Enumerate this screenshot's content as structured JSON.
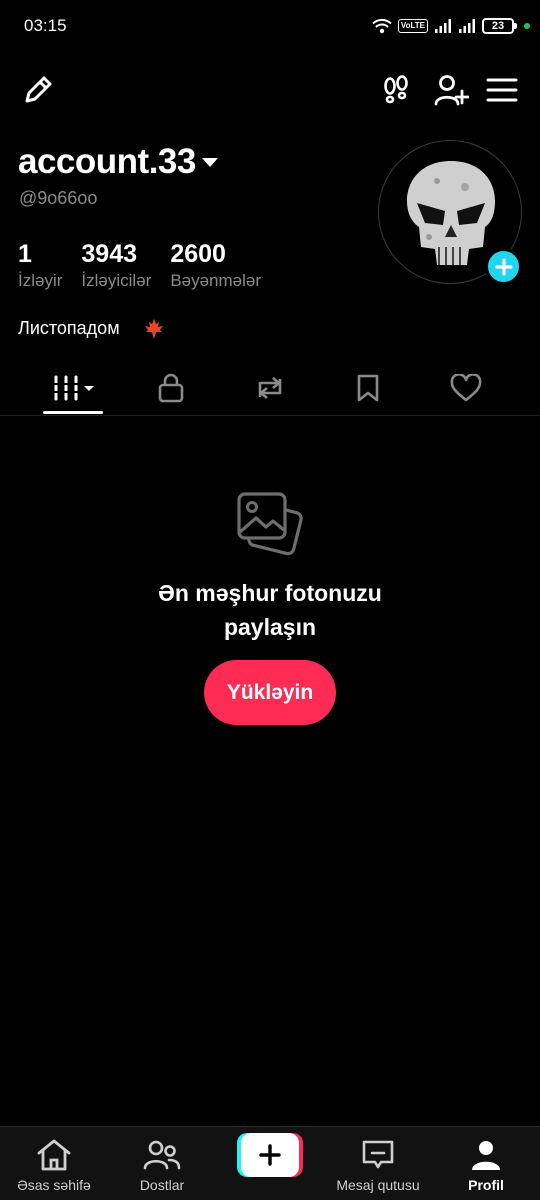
{
  "status_bar": {
    "time": "03:15",
    "volte": "VoLTE",
    "battery": "23"
  },
  "profile": {
    "username": "account.33",
    "handle": "@9o66oo",
    "bio": "Листопадом",
    "bio_emoji": "maple-leaf-icon",
    "stats": [
      {
        "value": "1",
        "label": "İzləyir"
      },
      {
        "value": "3943",
        "label": "İzləyicilər"
      },
      {
        "value": "2600",
        "label": "Bəyənmələr"
      }
    ]
  },
  "tabs": [
    {
      "icon": "grid-icon",
      "active": true
    },
    {
      "icon": "lock-icon"
    },
    {
      "icon": "repost-icon"
    },
    {
      "icon": "bookmark-icon"
    },
    {
      "icon": "heart-icon"
    }
  ],
  "empty_state": {
    "title_line1": "Ən məşhur fotonuzu",
    "title_line2": "paylaşın",
    "button_label": "Yükləyin"
  },
  "bottom_nav": [
    {
      "label": "Əsas səhifə",
      "icon": "home-icon"
    },
    {
      "label": "Dostlar",
      "icon": "friends-icon"
    },
    {
      "label": "",
      "icon": "plus-icon"
    },
    {
      "label": "Mesaj qutusu",
      "icon": "inbox-icon"
    },
    {
      "label": "Profil",
      "icon": "profile-icon",
      "active": true
    }
  ],
  "colors": {
    "accent": "#fe2c55",
    "add_badge": "#20d5ec",
    "secondary_text": "#8a8a8a"
  }
}
